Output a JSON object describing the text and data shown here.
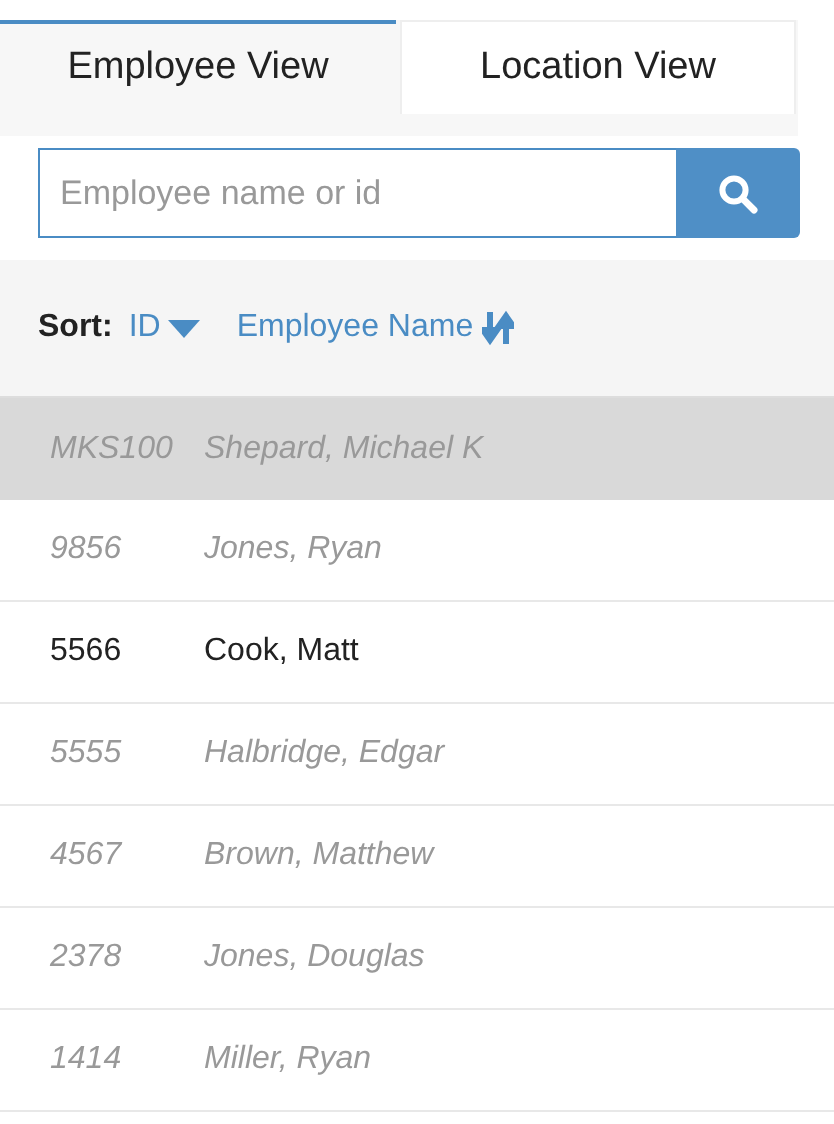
{
  "tabs": [
    {
      "label": "Employee View",
      "selected": true
    },
    {
      "label": "Location View",
      "selected": false
    }
  ],
  "search": {
    "placeholder": "Employee name or id"
  },
  "sort": {
    "label": "Sort:",
    "options": [
      {
        "label": "ID",
        "selected": true
      },
      {
        "label": "Employee Name",
        "selected": false
      }
    ]
  },
  "employees": [
    {
      "id": "MKS100",
      "name": "Shepard, Michael K",
      "selected": true,
      "inactive": true
    },
    {
      "id": "9856",
      "name": "Jones, Ryan",
      "selected": false,
      "inactive": true
    },
    {
      "id": "5566",
      "name": "Cook, Matt",
      "selected": false,
      "inactive": false
    },
    {
      "id": "5555",
      "name": "Halbridge, Edgar",
      "selected": false,
      "inactive": true
    },
    {
      "id": "4567",
      "name": "Brown, Matthew",
      "selected": false,
      "inactive": true
    },
    {
      "id": "2378",
      "name": "Jones, Douglas",
      "selected": false,
      "inactive": true
    },
    {
      "id": "1414",
      "name": "Miller, Ryan",
      "selected": false,
      "inactive": true
    }
  ]
}
